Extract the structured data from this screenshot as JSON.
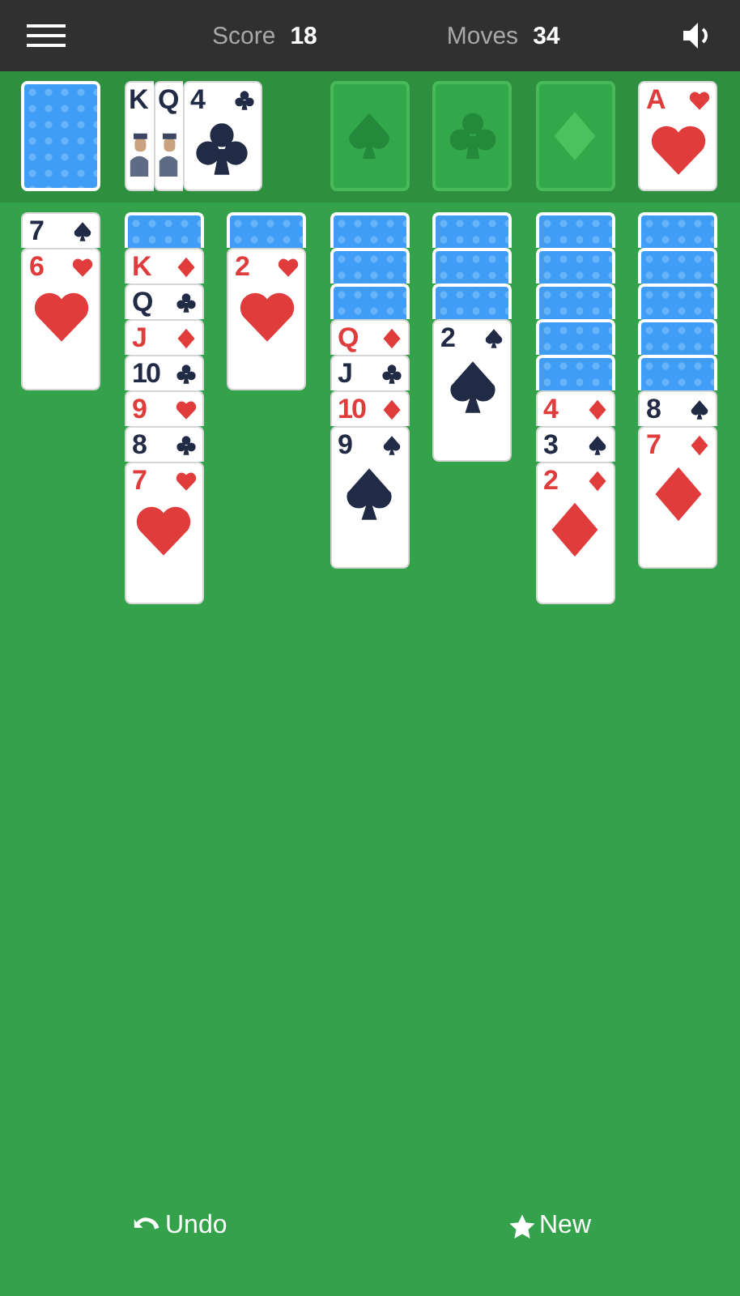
{
  "top_bar": {
    "score_label": "Score",
    "score": "18",
    "moves_label": "Moves",
    "moves": "34"
  },
  "stock": {
    "kind": "back"
  },
  "waste": [
    {
      "rank": "K",
      "figure": true
    },
    {
      "rank": "Q",
      "figure": true
    },
    {
      "rank": "4",
      "kind": "club",
      "figure": false
    }
  ],
  "foundations": [
    {
      "kind": "spade",
      "empty": true
    },
    {
      "kind": "club",
      "empty": true
    },
    {
      "kind": "diamond",
      "empty": true
    },
    {
      "kind": "heart",
      "empty": false,
      "rank": "A"
    }
  ],
  "tableau": [
    [
      {
        "kind": "spade",
        "rank": "7"
      },
      {
        "kind": "heart",
        "rank": "6"
      }
    ],
    [
      {
        "kind": "back"
      },
      {
        "kind": "diamond",
        "rank": "K"
      },
      {
        "kind": "club",
        "rank": "Q"
      },
      {
        "kind": "diamond",
        "rank": "J"
      },
      {
        "kind": "club",
        "rank": "10"
      },
      {
        "kind": "heart",
        "rank": "9"
      },
      {
        "kind": "club",
        "rank": "8"
      },
      {
        "kind": "heart",
        "rank": "7"
      }
    ],
    [
      {
        "kind": "back"
      },
      {
        "kind": "heart",
        "rank": "2"
      }
    ],
    [
      {
        "kind": "back"
      },
      {
        "kind": "back"
      },
      {
        "kind": "back"
      },
      {
        "kind": "diamond",
        "rank": "Q"
      },
      {
        "kind": "club",
        "rank": "J"
      },
      {
        "kind": "diamond",
        "rank": "10"
      },
      {
        "kind": "spade",
        "rank": "9"
      }
    ],
    [
      {
        "kind": "back"
      },
      {
        "kind": "back"
      },
      {
        "kind": "back"
      },
      {
        "kind": "spade",
        "rank": "2"
      }
    ],
    [
      {
        "kind": "back"
      },
      {
        "kind": "back"
      },
      {
        "kind": "back"
      },
      {
        "kind": "back"
      },
      {
        "kind": "back"
      },
      {
        "kind": "diamond",
        "rank": "4"
      },
      {
        "kind": "spade",
        "rank": "3"
      },
      {
        "kind": "diamond",
        "rank": "2"
      }
    ],
    [
      {
        "kind": "back"
      },
      {
        "kind": "back"
      },
      {
        "kind": "back"
      },
      {
        "kind": "back"
      },
      {
        "kind": "back"
      },
      {
        "kind": "spade",
        "rank": "8"
      },
      {
        "kind": "diamond",
        "rank": "7"
      }
    ]
  ],
  "bottom_bar": {
    "undo": "Undo",
    "new": "New"
  }
}
